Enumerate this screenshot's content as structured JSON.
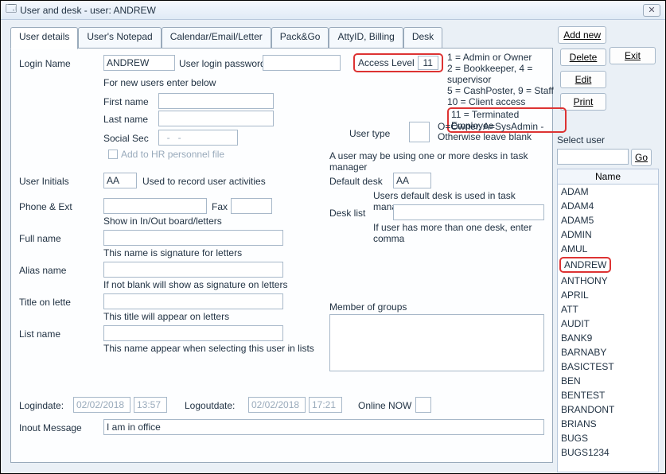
{
  "window": {
    "title": "User and desk - user: ANDREW"
  },
  "buttons": {
    "add_new": "Add new",
    "exit": "Exit",
    "delete": "Delete",
    "edit": "Edit",
    "print": "Print",
    "go": "Go"
  },
  "tabs": [
    "User details",
    "User's Notepad",
    "Calendar/Email/Letter",
    "Pack&Go",
    "AttyID, Billing",
    "Desk"
  ],
  "labels": {
    "login_name": "Login Name",
    "user_login_password": "User login password",
    "access_level": "Access Level",
    "for_new_users": "For new users enter below",
    "first_name": "First name",
    "last_name": "Last name",
    "social_sec": "Social Sec",
    "add_hr": "Add to HR personnel file",
    "user_type": "User type",
    "user_type_hint": "O=Owner, A=SysAdmin - Otherwise leave blank",
    "desks_note": "A user may be using one or more desks in task manager",
    "user_initials": "User Initials",
    "initials_hint": "Used to record user activities",
    "default_desk": "Default desk",
    "default_desk_hint": "Users default desk is used in task manager",
    "phone_ext": "Phone & Ext",
    "fax": "Fax",
    "show_in_out": "Show in In/Out board/letters",
    "desk_list": "Desk list",
    "desk_list_hint": "If user has more than one desk, enter comma",
    "full_name": "Full name",
    "full_name_hint": "This name is signature for letters",
    "alias_name": "Alias name",
    "alias_hint": "If not blank will show as signature on letters",
    "title_lette": "Title on lette",
    "title_hint": "This title will  appear on letters",
    "member_groups": "Member of groups",
    "list_name": "List name",
    "list_name_hint": "This name appear when selecting this user in lists",
    "logindate": "Logindate:",
    "logoutdate": "Logoutdate:",
    "online_now": "Online NOW",
    "inout_msg": "Inout Message",
    "select_user": "Select user",
    "name_col": "Name"
  },
  "access_lines": [
    "1 = Admin or Owner",
    "2 = Bookkeeper, 4 = supervisor",
    "5 = CashPoster, 9 = Staff",
    "10 = Client access",
    "11 = Terminated Employee"
  ],
  "values": {
    "login_name": "ANDREW",
    "access_level": "11",
    "social_sec": "  -   -",
    "user_initials": "AA",
    "default_desk": "AA",
    "logindate_date": "02/02/2018",
    "logindate_time": "13:57",
    "logoutdate_date": "02/02/2018",
    "logoutdate_time": "17:21",
    "inout_msg": "I am in office"
  },
  "userlist": [
    "ADAM",
    "ADAM4",
    "ADAM5",
    "ADMIN",
    "AMUL",
    "ANDREW",
    "ANTHONY",
    "APRIL",
    "ATT",
    "AUDIT",
    "BANK9",
    "BARNABY",
    "BASICTEST",
    "BEN",
    "BENTEST",
    "BRANDONT",
    "BRIANS",
    "BUGS",
    "BUGS1234"
  ],
  "selected_user": "ANDREW"
}
